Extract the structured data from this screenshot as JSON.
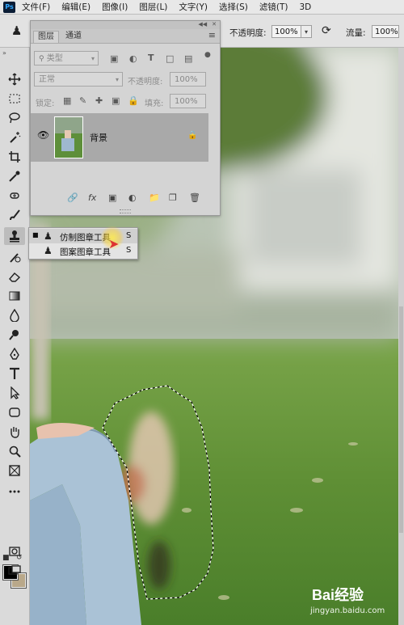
{
  "app": {
    "logo_text": "Ps"
  },
  "menubar": {
    "items": [
      "文件(F)",
      "编辑(E)",
      "图像(I)",
      "图层(L)",
      "文字(Y)",
      "选择(S)",
      "滤镜(T)",
      "3D"
    ]
  },
  "options_bar": {
    "opacity_label": "不透明度:",
    "opacity_value": "100%",
    "flow_label": "流量:",
    "flow_value": "100%"
  },
  "layers_panel": {
    "tabs": [
      "图层",
      "通道"
    ],
    "active_tab": "图层",
    "filter_placeholder": "类型",
    "blend_mode": "正常",
    "opacity_label": "不透明度:",
    "opacity_value": "100%",
    "lock_label": "锁定:",
    "fill_label": "填充:",
    "fill_value": "100%",
    "layer": {
      "name": "背景",
      "visible": true,
      "locked": true
    }
  },
  "tool_flyout": {
    "items": [
      {
        "label": "仿制图章工具",
        "shortcut": "S",
        "selected": true
      },
      {
        "label": "图案图章工具",
        "shortcut": "S",
        "selected": false
      }
    ]
  },
  "colors": {
    "foreground": "#000000",
    "background": "#b9a88a",
    "accent": "#31a8ff"
  },
  "watermark": {
    "text": "jingyan.baidu.com",
    "logo_text": "Bai经验"
  }
}
